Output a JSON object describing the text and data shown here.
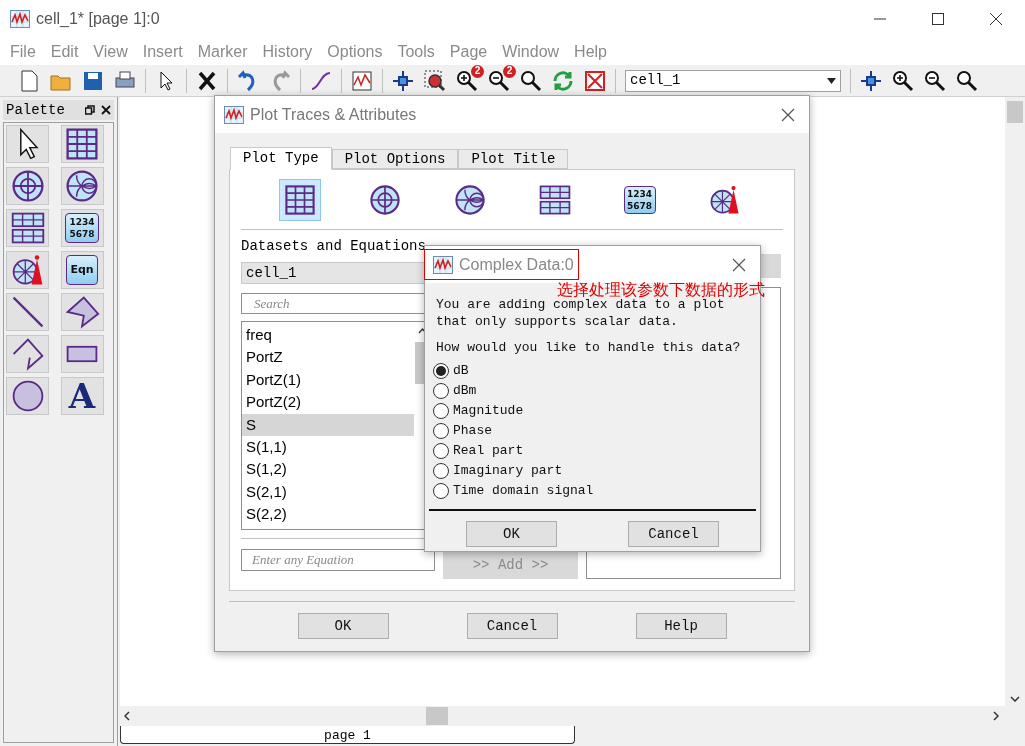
{
  "window": {
    "title": "cell_1* [page 1]:0"
  },
  "menu": [
    "File",
    "Edit",
    "View",
    "Insert",
    "Marker",
    "History",
    "Options",
    "Tools",
    "Page",
    "Window",
    "Help"
  ],
  "toolbar": [
    {
      "kind": "new"
    },
    {
      "kind": "open"
    },
    {
      "kind": "save"
    },
    {
      "kind": "print"
    },
    {
      "kind": "sep"
    },
    {
      "kind": "pointer"
    },
    {
      "kind": "sep"
    },
    {
      "kind": "delete"
    },
    {
      "kind": "sep"
    },
    {
      "kind": "undo"
    },
    {
      "kind": "redo"
    },
    {
      "kind": "sep"
    },
    {
      "kind": "curve"
    },
    {
      "kind": "sep"
    },
    {
      "kind": "plot"
    },
    {
      "kind": "sep"
    },
    {
      "kind": "pan"
    },
    {
      "kind": "zoom-box"
    },
    {
      "kind": "zoom-in",
      "badge": "2"
    },
    {
      "kind": "zoom-out",
      "badge": "2"
    },
    {
      "kind": "zoom"
    },
    {
      "kind": "refresh"
    },
    {
      "kind": "close-box"
    },
    {
      "kind": "sep"
    },
    {
      "kind": "select",
      "value": "cell_1"
    },
    {
      "kind": "sep"
    },
    {
      "kind": "pan"
    },
    {
      "kind": "zoom-in"
    },
    {
      "kind": "zoom-out"
    },
    {
      "kind": "zoom"
    }
  ],
  "palette": {
    "title": "Palette",
    "items": [
      {
        "kind": "pointer"
      },
      {
        "kind": "rect"
      },
      {
        "kind": "polar"
      },
      {
        "kind": "smith"
      },
      {
        "kind": "stacked"
      },
      {
        "kind": "table",
        "lines": [
          "1234",
          "5678"
        ]
      },
      {
        "kind": "antenna"
      },
      {
        "kind": "equation",
        "label": "Eqn"
      },
      {
        "kind": "line"
      },
      {
        "kind": "polygon"
      },
      {
        "kind": "polyline"
      },
      {
        "kind": "rectangle"
      },
      {
        "kind": "circle"
      },
      {
        "kind": "text",
        "label": "A"
      }
    ]
  },
  "plot_dialog": {
    "title": "Plot Traces & Attributes",
    "tabs": [
      {
        "label": "Plot Type",
        "selected": true
      },
      {
        "label": "Plot Options",
        "selected": false
      },
      {
        "label": "Plot Title",
        "selected": false
      }
    ],
    "plot_types": [
      {
        "kind": "rect",
        "selected": true
      },
      {
        "kind": "polar",
        "selected": false
      },
      {
        "kind": "smith",
        "selected": false
      },
      {
        "kind": "stacked",
        "selected": false
      },
      {
        "kind": "table",
        "lines": [
          "1234",
          "5678"
        ],
        "selected": false
      },
      {
        "kind": "antenna",
        "selected": false
      }
    ],
    "datasets_label": "Datasets and Equations",
    "dataset_select": "cell_1",
    "search": {
      "placeholder": "Search"
    },
    "list": [
      {
        "label": "freq",
        "selected": false
      },
      {
        "label": "PortZ",
        "selected": false
      },
      {
        "label": "PortZ(1)",
        "selected": false
      },
      {
        "label": "PortZ(2)",
        "selected": false
      },
      {
        "label": "S",
        "selected": true
      },
      {
        "label": "S(1,1)",
        "selected": false
      },
      {
        "label": "S(1,2)",
        "selected": false
      },
      {
        "label": "S(2,1)",
        "selected": false
      },
      {
        "label": "S(2,2)",
        "selected": false
      }
    ],
    "equation": {
      "placeholder": "Enter any Equation"
    },
    "add_button": {
      "label": ">> Add >>",
      "disabled": true
    },
    "buttons": [
      "OK",
      "Cancel",
      "Help"
    ]
  },
  "complex_dialog": {
    "title": "Complex Data:0",
    "annotation": "选择处理该参数下数据的形式",
    "message": [
      "You are adding complex data to a plot",
      "that only supports scalar data."
    ],
    "question": "How would you like to handle this data?",
    "options": [
      {
        "label": "dB",
        "selected": true
      },
      {
        "label": "dBm",
        "selected": false
      },
      {
        "label": "Magnitude",
        "selected": false
      },
      {
        "label": "Phase",
        "selected": false
      },
      {
        "label": "Real part",
        "selected": false
      },
      {
        "label": "Imaginary part",
        "selected": false
      },
      {
        "label": "Time domain signal",
        "selected": false
      }
    ],
    "buttons": [
      "OK",
      "Cancel"
    ]
  },
  "page_tab": "page 1"
}
